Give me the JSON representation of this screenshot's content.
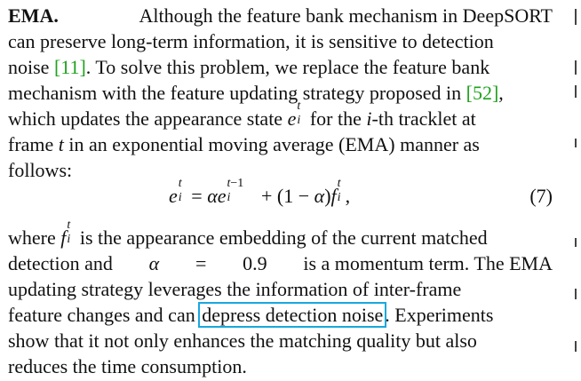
{
  "paragraph1": {
    "heading": "EMA.",
    "line1_rest": "Although the feature bank mechanism in DeepSORT",
    "line2": "can preserve long-term information, it is sensitive to detection",
    "line3_pre": "noise ",
    "cite1": "[11]",
    "line3_post": ". To solve this problem, we replace the feature bank",
    "line4_pre": "mechanism with the feature updating strategy proposed in ",
    "cite2": "[52]",
    "line4_post": ",",
    "line5_pre": "which updates the appearance state ",
    "line5_var": "e",
    "line5_sup": "t",
    "line5_sub": "i",
    "line5_mid": " for the ",
    "line5_i": "i",
    "line5_post": "-th tracklet at",
    "line6_pre": "frame ",
    "line6_t": "t",
    "line6_post": " in an exponential moving average (EMA) manner as",
    "line7": "follows:"
  },
  "equation": {
    "number": "(7)"
  },
  "paragraph2": {
    "line1_pre": "where ",
    "line1_post": " is the appearance embedding of the current matched",
    "line2_pre": "detection and ",
    "line2_alpha": "α",
    "line2_eq": " = ",
    "line2_val": "0.9",
    "line2_post": " is a momentum term. The EMA",
    "line3": "updating strategy leverages the information of inter-frame",
    "line4_pre": "feature changes and can ",
    "line4_highlight": "depress detection noise",
    "line4_post": ". Experiments",
    "line5": "show that it not only enhances the matching quality but also",
    "line6": "reduces the time consumption."
  }
}
